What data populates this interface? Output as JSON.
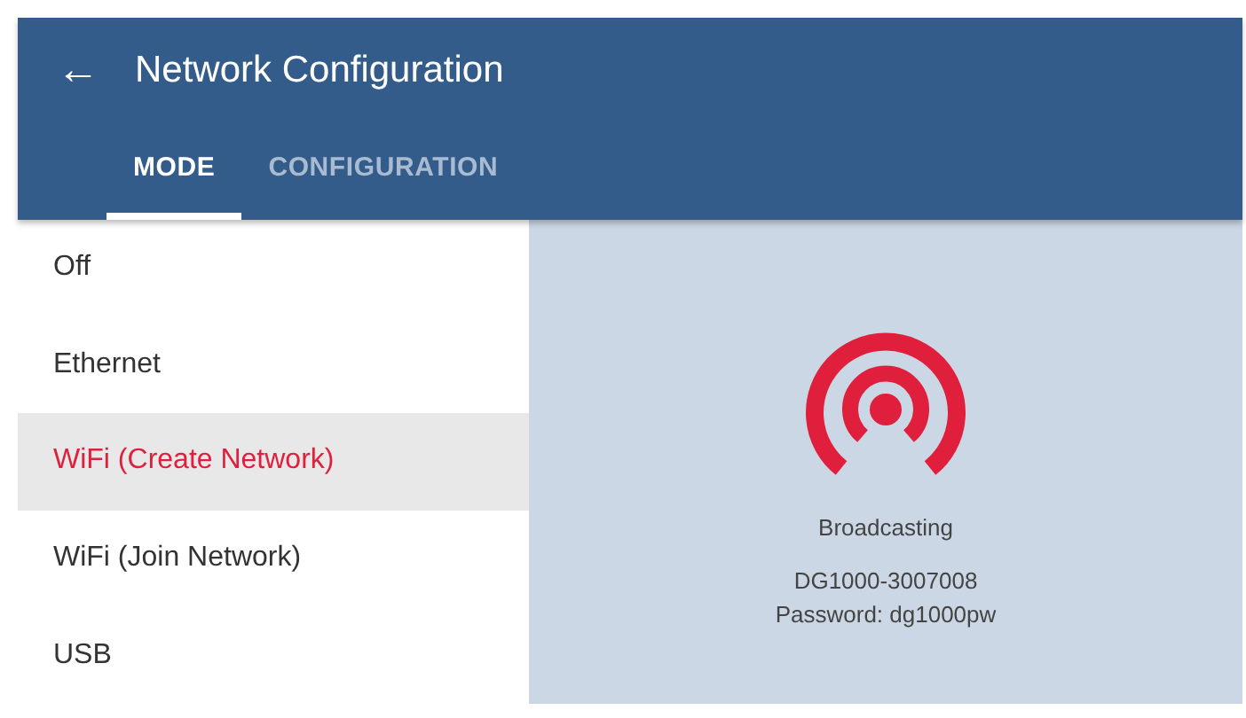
{
  "app_bar": {
    "back_icon": "←",
    "title": "Network Configuration"
  },
  "tabs": [
    {
      "label": "MODE",
      "selected": true
    },
    {
      "label": "CONFIGURATION",
      "selected": false
    }
  ],
  "modes": [
    {
      "label": "Off",
      "selected": false
    },
    {
      "label": "Ethernet",
      "selected": false
    },
    {
      "label": "WiFi (Create Network)",
      "selected": true
    },
    {
      "label": "WiFi (Join Network)",
      "selected": false
    },
    {
      "label": "USB",
      "selected": false
    }
  ],
  "status": {
    "state": "Broadcasting",
    "network_name": "DG1000-3007008",
    "password": "Password: dg1000pw"
  }
}
